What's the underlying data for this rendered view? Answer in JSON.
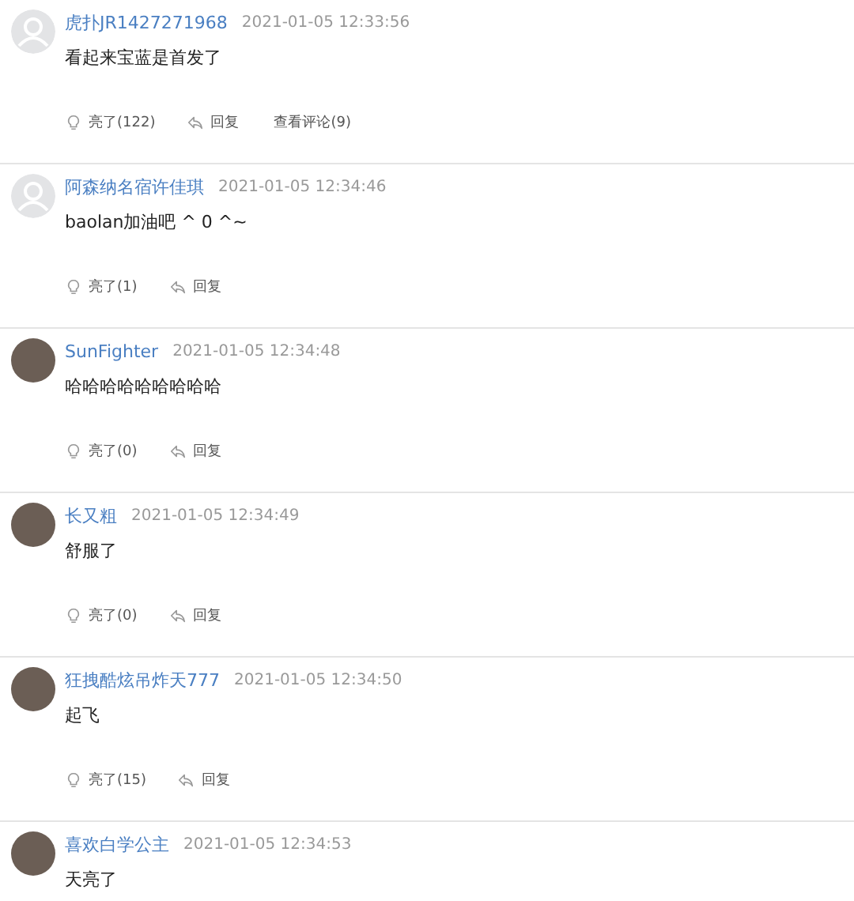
{
  "comments": [
    {
      "kind": "default",
      "user": "虎扑JR1427271968",
      "time": "2021-01-05 12:33:56",
      "text": "看起来宝蓝是首发了",
      "actions": {
        "like": "亮了(122)",
        "reply": "回复",
        "view_replies": "查看评论(9)"
      }
    },
    {
      "kind": "default",
      "user": "阿森纳名宿许佳琪",
      "time": "2021-01-05 12:34:46",
      "text": "baolan加油吧 ^ 0 ^~",
      "actions": {
        "like": "亮了(1)",
        "reply": "回复"
      }
    },
    {
      "kind": "photo",
      "user": "SunFighter",
      "time": "2021-01-05 12:34:48",
      "text": "哈哈哈哈哈哈哈哈哈",
      "actions": {
        "like": "亮了(0)",
        "reply": "回复"
      }
    },
    {
      "kind": "photo",
      "user": "长又粗",
      "time": "2021-01-05 12:34:49",
      "text": "舒服了",
      "actions": {
        "like": "亮了(0)",
        "reply": "回复"
      }
    },
    {
      "kind": "photo",
      "user": "狂拽酷炫吊炸天777",
      "time": "2021-01-05 12:34:50",
      "text": "起飞",
      "actions": {
        "like": "亮了(15)",
        "reply": "回复"
      }
    },
    {
      "kind": "photo",
      "user": "喜欢白学公主",
      "time": "2021-01-05 12:34:53",
      "text": "天亮了"
    }
  ]
}
